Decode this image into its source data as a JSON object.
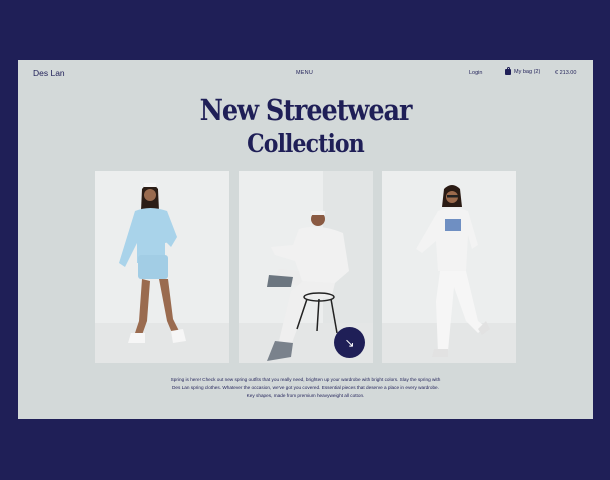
{
  "nav": {
    "brand": "Des Lan",
    "menu": "MENU",
    "login": "Login",
    "bag": "My bag (2)",
    "price": "€ 213.00"
  },
  "hero": {
    "title_line1": "New Streetwear",
    "title_line2": "Collection"
  },
  "description": "Spring is here! Check out new spring outfits that you really need, brighten up your wardrobe with bright colors. Slay the spring with Des Lan spring clothes. Whatever the occasion, we've got you covered. Essential pieces that deserve a place in every wardrobe. Key shapes, made from premium heavyweight all cotton.",
  "icons": {
    "bag": "shopping-bag-icon",
    "arrow": "arrow-down-right-icon"
  },
  "colors": {
    "background": "#1f1f57",
    "panel": "#d3d9d9",
    "accent": "#1f1f57"
  }
}
